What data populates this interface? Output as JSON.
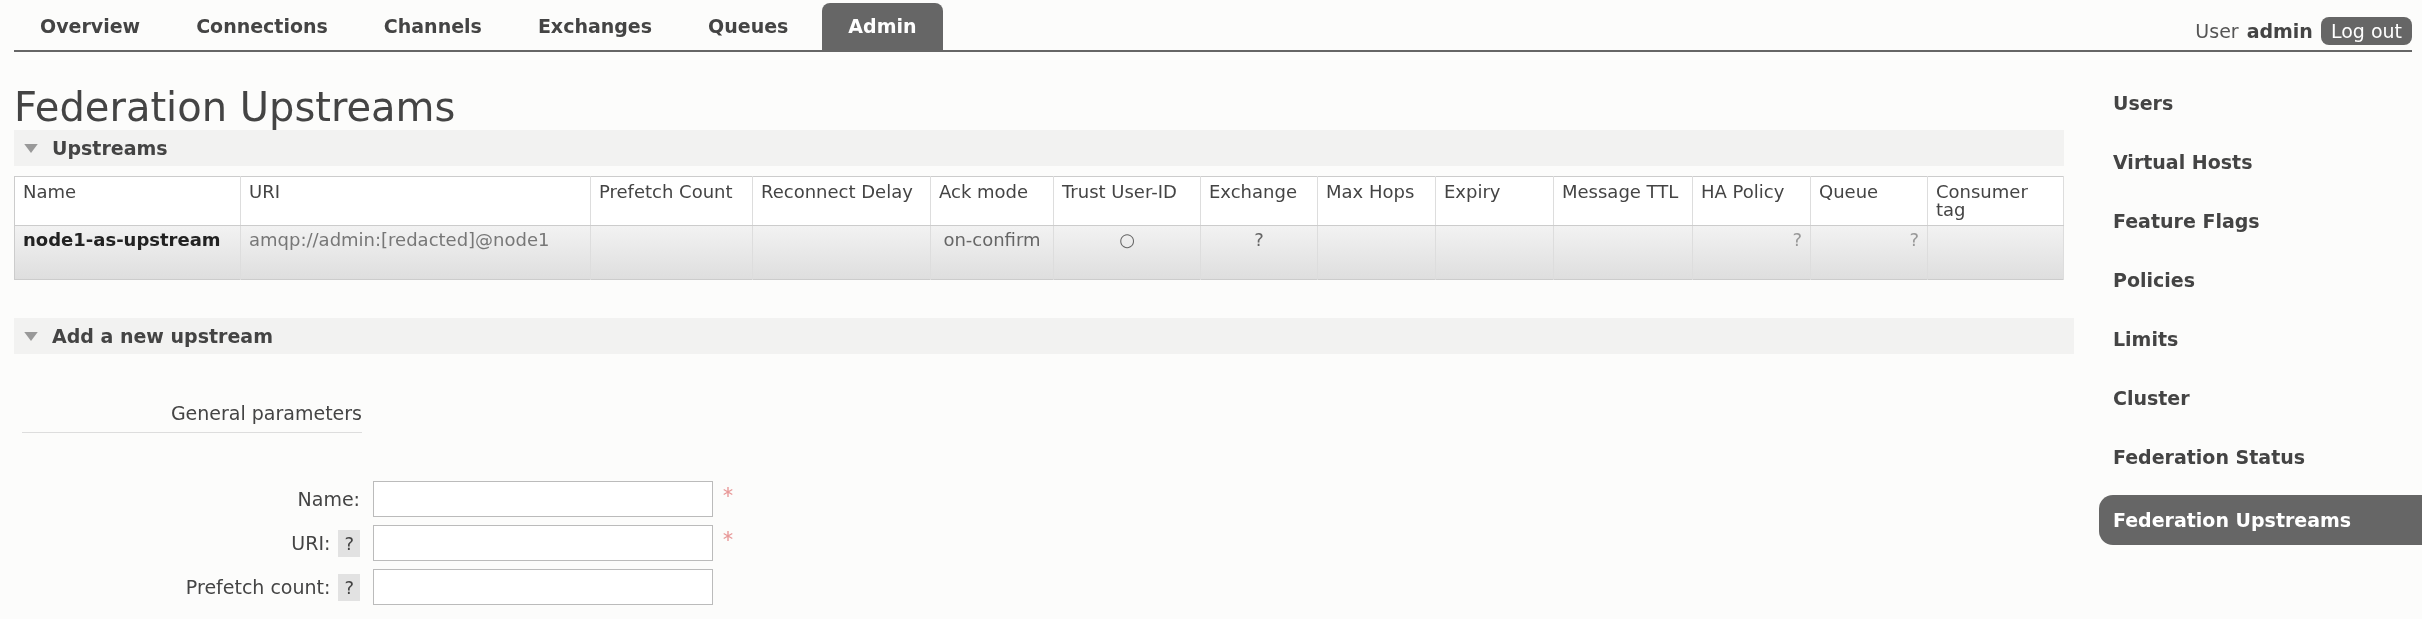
{
  "nav_tabs": [
    {
      "label": "Overview",
      "selected": false
    },
    {
      "label": "Connections",
      "selected": false
    },
    {
      "label": "Channels",
      "selected": false
    },
    {
      "label": "Exchanges",
      "selected": false
    },
    {
      "label": "Queues",
      "selected": false
    },
    {
      "label": "Admin",
      "selected": true
    }
  ],
  "user": {
    "prefix": "User",
    "name": "admin",
    "logout": "Log out"
  },
  "page_title": "Federation Upstreams",
  "upstreams_section": {
    "title": "Upstreams",
    "expanded": true,
    "table": {
      "columns": [
        "Name",
        "URI",
        "Prefetch Count",
        "Reconnect Delay",
        "Ack mode",
        "Trust User-ID",
        "Exchange",
        "Max Hops",
        "Expiry",
        "Message TTL",
        "HA Policy",
        "Queue",
        "Consumer tag"
      ],
      "rows": [
        {
          "cells": [
            {
              "text": "node1-as-upstream",
              "kind": "name"
            },
            {
              "text": "amqp://admin:[redacted]@node1",
              "kind": "muted"
            },
            {
              "text": "",
              "kind": "plain"
            },
            {
              "text": "",
              "kind": "plain"
            },
            {
              "text": "on-confirm",
              "kind": "center"
            },
            {
              "text": "○",
              "kind": "center"
            },
            {
              "text": "?",
              "kind": "center"
            },
            {
              "text": "",
              "kind": "plain"
            },
            {
              "text": "",
              "kind": "plain"
            },
            {
              "text": "",
              "kind": "plain"
            },
            {
              "text": "?",
              "kind": "right"
            },
            {
              "text": "?",
              "kind": "right"
            },
            {
              "text": "",
              "kind": "plain"
            }
          ]
        }
      ]
    }
  },
  "add_section": {
    "title": "Add a new upstream",
    "expanded": true,
    "group_title": "General parameters",
    "fields": [
      {
        "label": "Name:",
        "help": false,
        "required": true
      },
      {
        "label": "URI:",
        "help": true,
        "help_text": "?",
        "required": true
      },
      {
        "label": "Prefetch count:",
        "help": true,
        "help_text": "?",
        "required": false
      }
    ]
  },
  "sidebar": {
    "items": [
      {
        "label": "Users",
        "selected": false
      },
      {
        "label": "Virtual Hosts",
        "selected": false
      },
      {
        "label": "Feature Flags",
        "selected": false
      },
      {
        "label": "Policies",
        "selected": false
      },
      {
        "label": "Limits",
        "selected": false
      },
      {
        "label": "Cluster",
        "selected": false
      },
      {
        "label": "Federation Status",
        "selected": false
      },
      {
        "label": "Federation Upstreams",
        "selected": true
      }
    ]
  }
}
